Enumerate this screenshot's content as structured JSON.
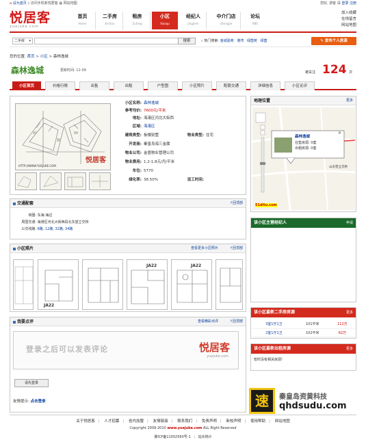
{
  "topbar": {
    "set_home": "设为首页",
    "mobile": "访问手机新悦居客",
    "sitemap": "网站地图",
    "greeting": "您好, 游客",
    "sep": "请",
    "login": "登录",
    "register": "注册"
  },
  "logo": {
    "text": "悦居客",
    "sub": "yuejuke.com"
  },
  "nav": [
    {
      "zh": "首页",
      "en": "Home"
    },
    {
      "zh": "二手房",
      "en": "Ershou"
    },
    {
      "zh": "租房",
      "en": "Zufang"
    },
    {
      "zh": "小区",
      "en": "Xiaoqu"
    },
    {
      "zh": "经纪人",
      "en": "Jingjiren"
    },
    {
      "zh": "中介门店",
      "en": "Zhongjie"
    },
    {
      "zh": "论坛",
      "en": "BBS"
    }
  ],
  "right_links": [
    "加入收藏",
    "在线留言",
    "网站地图"
  ],
  "search": {
    "select_value": "二手房",
    "button": "搜索",
    "hot_label": "热门搜索:",
    "hot_items": [
      "金城嘉苑",
      "港湾",
      "绿茵苑",
      "绿茵"
    ],
    "publish": "发布个人房源"
  },
  "breadcrumb": {
    "prefix": "您的位置:",
    "home": "首页",
    "sep": ">",
    "section": "小区",
    "current": "森林逸城"
  },
  "page": {
    "title": "森林逸城",
    "updated": "更新时间: 12-09",
    "watch_label": "被关注",
    "watch_count": "124",
    "watch_unit": "次"
  },
  "tabs": [
    "小区首页",
    "价格行情",
    "出售",
    "出租",
    "户型图",
    "小区照片",
    "配套交通",
    "详细信息",
    "小区论评"
  ],
  "info": {
    "rows": [
      {
        "k": "小区名称:",
        "v": "森林逸城"
      },
      {
        "k": "参考均价:",
        "v": "7600元/平米"
      },
      {
        "k": "地址:",
        "v": "海港区河北大街西"
      },
      {
        "k": "区域:",
        "v": "海港区"
      },
      {
        "k": "建筑类型:",
        "v": "板楼别墅"
      },
      {
        "k": "开发商:",
        "v": "秦皇岛海三金属"
      },
      {
        "k": "物业公司:",
        "v": "金盾物业管理公司"
      },
      {
        "k": "物业费用:",
        "v": "1.2-1.8元/月/平米"
      },
      {
        "k": "车位:",
        "v": "5770"
      },
      {
        "k": "绿化率:",
        "v": "38.50%"
      }
    ],
    "type_label": "物业类型:",
    "type_value": "住宅",
    "finish_label": "设工时间:",
    "finish_value": "",
    "brand_mark": "悦居客",
    "img_url_text": "HTTP://WWW.YUEJUKE.COM"
  },
  "traffic": {
    "title": "交通配套",
    "back_top": "回顶部",
    "rows": [
      {
        "k": "商圈:",
        "v": "东海:海边"
      },
      {
        "k": "周围交通:",
        "v": "海港区河北大街西段北东望立交桥"
      },
      {
        "k": "公交线路:",
        "v": "8路, 12路, 32路, 34路"
      }
    ]
  },
  "photos": {
    "title": "小区照片",
    "more": "查看更多小区照片",
    "back_top": "回顶部"
  },
  "review": {
    "title": "我要点评",
    "more": "查看精彩点评",
    "back_top": "回顶部",
    "login_prompt": "登录之后可以发表评论",
    "brand": "悦居客",
    "brand_sub": "yuejuke.com",
    "button": "请先登录",
    "tip_label": "友情提示:",
    "tip_link": "点击登录"
  },
  "map": {
    "title": "地理位置",
    "more": "更多",
    "popup_title": "森林逸城",
    "popup_sale": "在售房源: 0套",
    "popup_rent": "出租房源: 0套",
    "road_label": "山东堡立交桥",
    "credit": "51ditu.com"
  },
  "agents": {
    "title": "该小区主营经纪人",
    "more": "申请"
  },
  "sale": {
    "title": "该小区最新二手房房源",
    "more": "更多",
    "rows": [
      {
        "layout": "3室1厅1卫",
        "area": "101平米",
        "price": "112万"
      },
      {
        "layout": "2室1厅1卫",
        "area": "102平米",
        "price": "62万"
      }
    ]
  },
  "rent": {
    "title": "该小区最新出租房源",
    "more": "更多",
    "empty": "暂时没有相关房源!"
  },
  "footer": {
    "links": [
      "关于悦居客",
      "人才招募",
      "省内加盟",
      "友情链接",
      "联系我们",
      "免责声明",
      "新校声明",
      "使用帮助",
      "网站地图"
    ],
    "copyright_pre": "Copyright 2009-2010",
    "copyright_site": "www.yuejuke.com",
    "copyright_post": "ALL Right Reserved",
    "icp": "冀ICP备11002560号-1",
    "stats": "站长统计"
  },
  "watermark": {
    "logo": "速",
    "cn": "秦皇岛资黄科技",
    "url": "qhdsudu.com"
  },
  "colors": {
    "brand_red": "#c81c17",
    "title_green": "#3b8a24",
    "link_blue": "#0b3f9b",
    "orange": "#e85d10"
  }
}
